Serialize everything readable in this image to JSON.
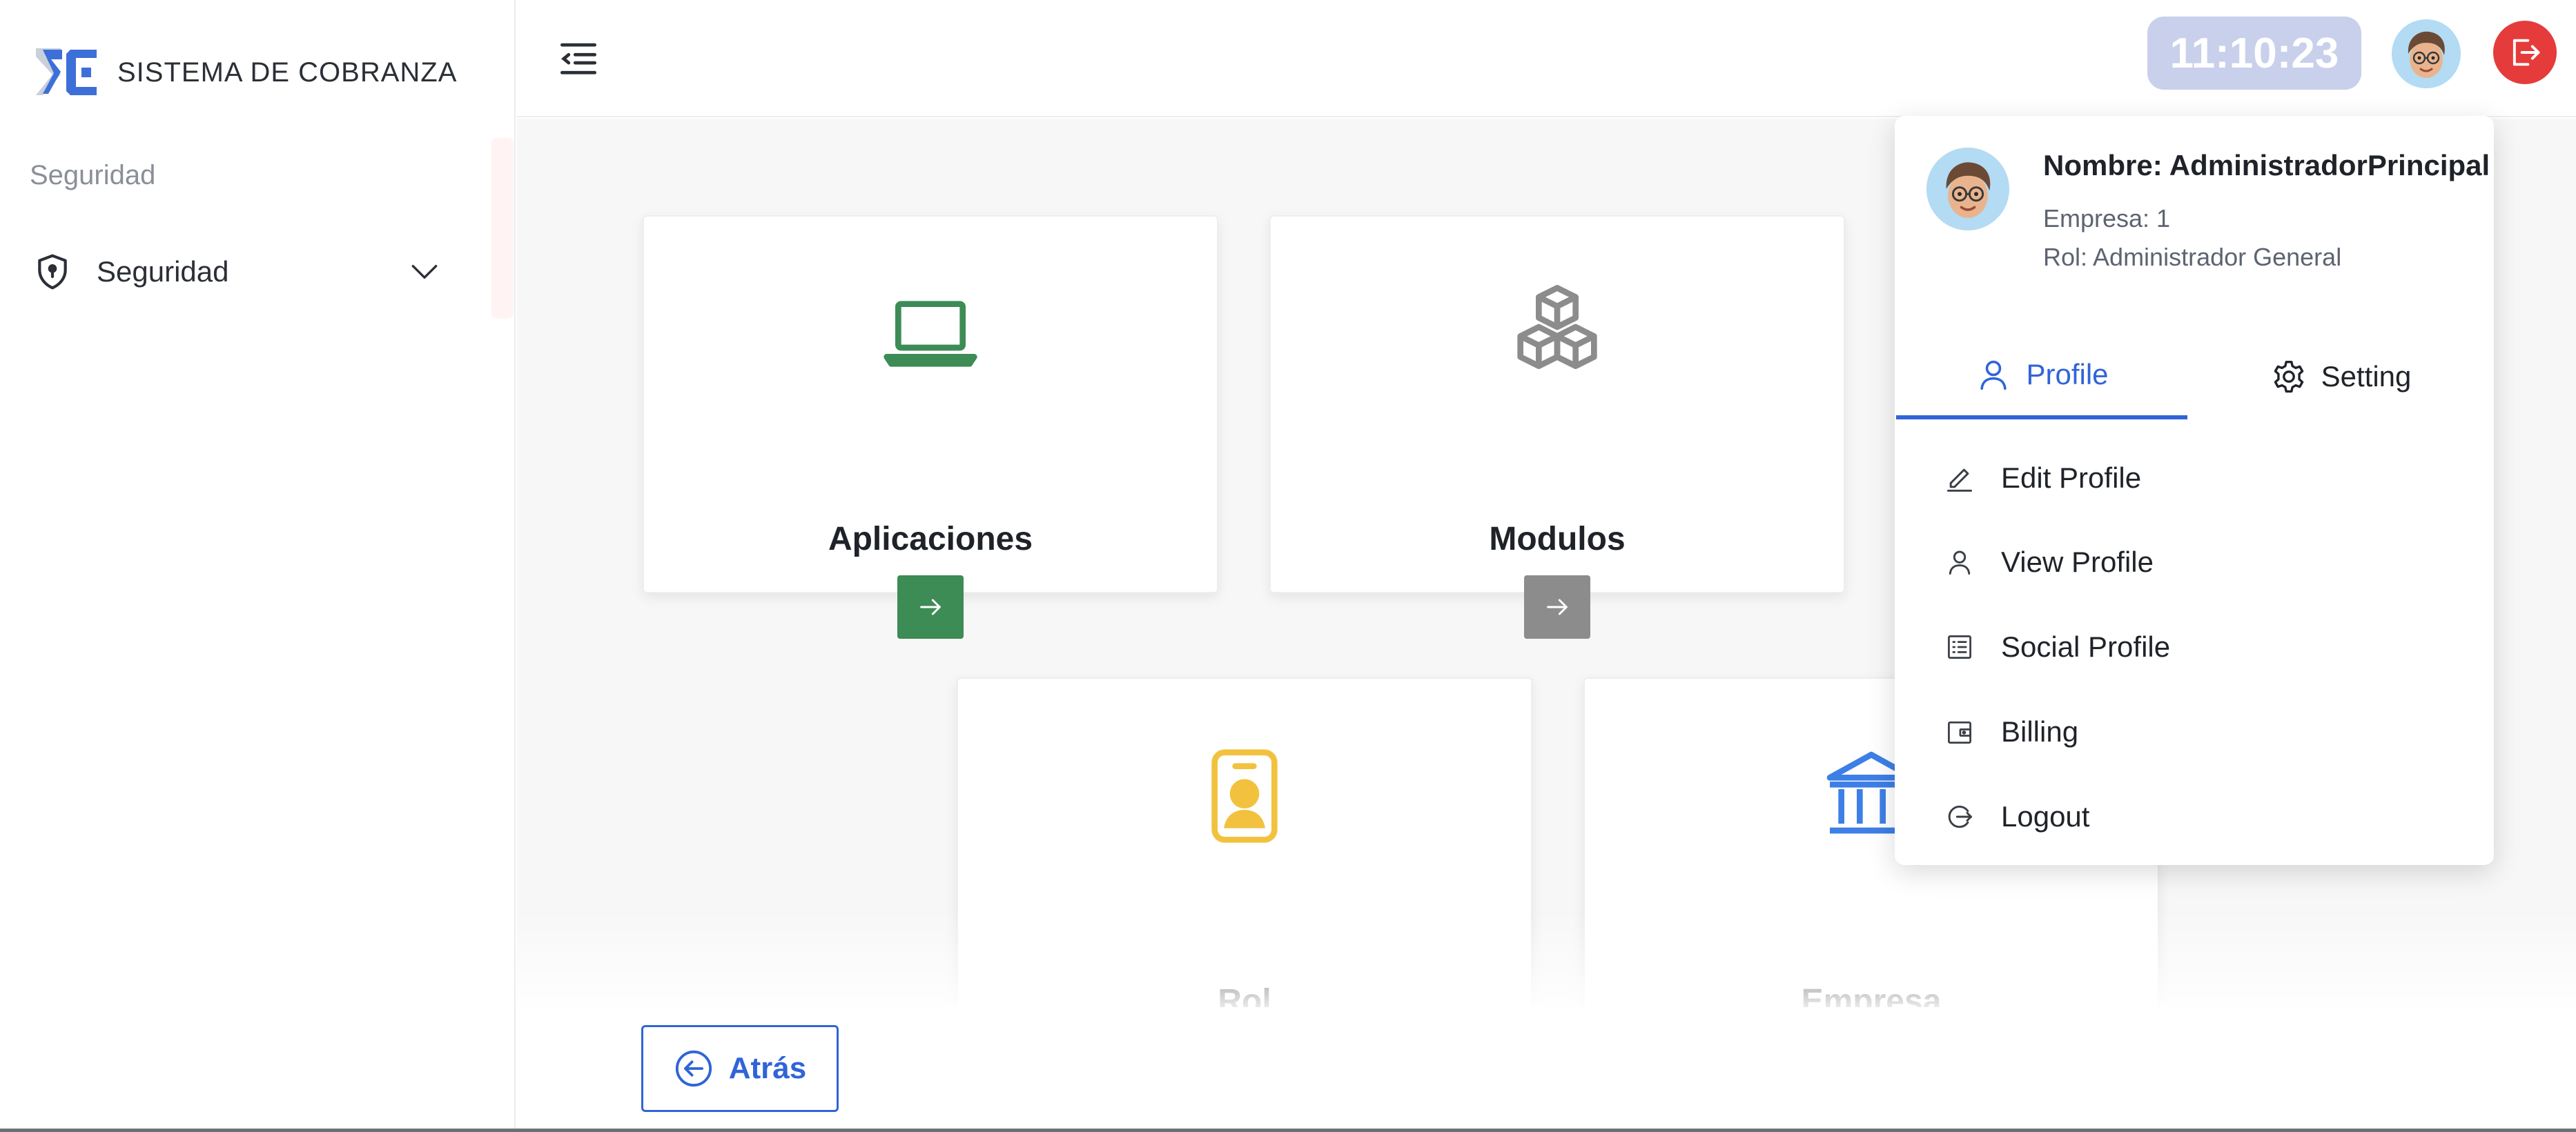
{
  "app": {
    "name": "SISTEMA DE COBRANZA"
  },
  "sidebar": {
    "caption": "Seguridad",
    "items": [
      {
        "label": "Seguridad",
        "icon": "shield-icon",
        "expanded": false
      }
    ]
  },
  "header": {
    "clock": "11:10:23",
    "avatar_icon": "user-avatar",
    "logout_icon": "logout-icon"
  },
  "cards": [
    {
      "title": "Aplicaciones",
      "icon": "laptop-icon",
      "color": "#3d8b55"
    },
    {
      "title": "Modulos",
      "icon": "cubes-icon",
      "color": "#8c8c8c"
    },
    {
      "title": "Rol",
      "icon": "id-badge-icon",
      "color": "#f2c23e"
    },
    {
      "title": "Empresa",
      "icon": "bank-icon",
      "color": "#3d7fe6"
    }
  ],
  "footer": {
    "back_label": "Atrás"
  },
  "profile_dropdown": {
    "name": "Nombre: AdministradorPrincipal",
    "company": "Empresa: 1",
    "role": "Rol: Administrador General",
    "tabs": [
      {
        "label": "Profile",
        "icon": "user-icon",
        "active": true
      },
      {
        "label": "Setting",
        "icon": "gear-icon",
        "active": false
      }
    ],
    "menu": [
      {
        "label": "Edit Profile",
        "icon": "edit-icon"
      },
      {
        "label": "View Profile",
        "icon": "user-icon"
      },
      {
        "label": "Social Profile",
        "icon": "list-icon"
      },
      {
        "label": "Billing",
        "icon": "wallet-icon"
      },
      {
        "label": "Logout",
        "icon": "logout-icon"
      }
    ]
  },
  "colors": {
    "primary": "#3064d8",
    "danger": "#e63b3b",
    "clock_bg": "#c8d0eb"
  }
}
